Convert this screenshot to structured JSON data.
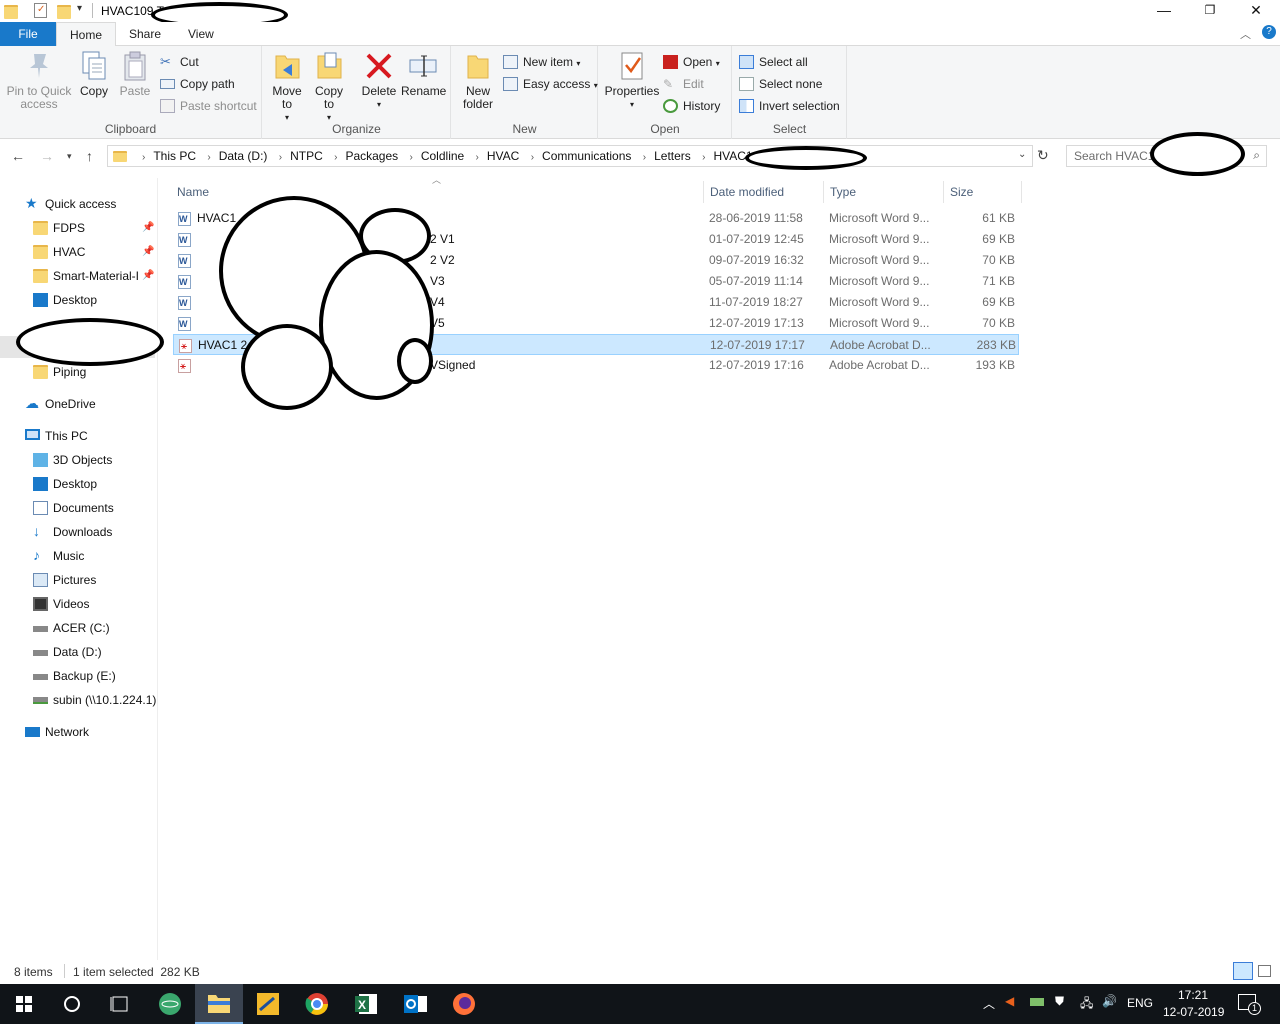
{
  "window": {
    "title": "HVAC109 T",
    "controls": [
      "minimize",
      "maximize",
      "close"
    ]
  },
  "tabs": [
    {
      "label": "File"
    },
    {
      "label": "Home"
    },
    {
      "label": "Share"
    },
    {
      "label": "View"
    }
  ],
  "ribbon": {
    "clipboard": {
      "label": "Clipboard",
      "pin": "Pin to Quick access",
      "copy": "Copy",
      "paste": "Paste",
      "cut": "Cut",
      "copy_path": "Copy path",
      "paste_shortcut": "Paste shortcut"
    },
    "organize": {
      "label": "Organize",
      "move_to": "Move to",
      "copy_to": "Copy to",
      "delete": "Delete",
      "rename": "Rename"
    },
    "new": {
      "label": "New",
      "new_folder": "New folder",
      "new_item": "New item",
      "easy_access": "Easy access"
    },
    "open": {
      "label": "Open",
      "properties": "Properties",
      "open": "Open",
      "edit": "Edit",
      "history": "History"
    },
    "select": {
      "label": "Select",
      "select_all": "Select all",
      "select_none": "Select none",
      "invert": "Invert selection"
    }
  },
  "address": {
    "crumbs": [
      "This PC",
      "Data (D:)",
      "NTPC",
      "Packages",
      "Coldline",
      "HVAC",
      "Communications",
      "Letters",
      "HVAC109"
    ],
    "search_placeholder": "Search HVAC1"
  },
  "sidebar": {
    "quick_access": "Quick access",
    "pinned": [
      {
        "label": "FDPS",
        "pinned": true
      },
      {
        "label": "HVAC",
        "pinned": true
      },
      {
        "label": "Smart-Material-I",
        "pinned": true
      },
      {
        "label": "Desktop",
        "pinned": false
      },
      {
        "label": "Piping",
        "pinned": false
      }
    ],
    "onedrive": "OneDrive",
    "this_pc": "This PC",
    "pc_items": [
      {
        "label": "3D Objects",
        "icon": "3d-objects-icon"
      },
      {
        "label": "Desktop",
        "icon": "desktop-icon"
      },
      {
        "label": "Documents",
        "icon": "documents-icon"
      },
      {
        "label": "Downloads",
        "icon": "downloads-icon"
      },
      {
        "label": "Music",
        "icon": "music-icon"
      },
      {
        "label": "Pictures",
        "icon": "pictures-icon"
      },
      {
        "label": "Videos",
        "icon": "videos-icon"
      },
      {
        "label": "ACER (C:)",
        "icon": "drive-icon"
      },
      {
        "label": "Data (D:)",
        "icon": "drive-icon"
      },
      {
        "label": "Backup (E:)",
        "icon": "drive-icon"
      },
      {
        "label": "subin (\\\\10.1.224.1)",
        "icon": "network-drive-icon"
      }
    ],
    "network": "Network"
  },
  "columns": {
    "name": "Name",
    "date": "Date modified",
    "type": "Type",
    "size": "Size"
  },
  "files": [
    {
      "name": "HVAC1",
      "date": "28-06-2019 11:58",
      "type": "Microsoft Word 9...",
      "size": "61 KB",
      "kind": "word",
      "selected": false
    },
    {
      "name": "2 V1",
      "date": "01-07-2019 12:45",
      "type": "Microsoft Word 9...",
      "size": "69 KB",
      "kind": "word",
      "selected": false
    },
    {
      "name": "2 V2",
      "date": "09-07-2019 16:32",
      "type": "Microsoft Word 9...",
      "size": "70 KB",
      "kind": "word",
      "selected": false
    },
    {
      "name": "V3",
      "date": "05-07-2019 11:14",
      "type": "Microsoft Word 9...",
      "size": "71 KB",
      "kind": "word",
      "selected": false
    },
    {
      "name": "V4",
      "date": "11-07-2019 18:27",
      "type": "Microsoft Word 9...",
      "size": "69 KB",
      "kind": "word",
      "selected": false
    },
    {
      "name": "V5",
      "date": "12-07-2019 17:13",
      "type": "Microsoft Word 9...",
      "size": "70 KB",
      "kind": "word",
      "selected": false
    },
    {
      "name": "HVAC1 2 Vetting",
      "date": "12-07-2019 17:17",
      "type": "Adobe Acrobat D...",
      "size": "283 KB",
      "kind": "pdf",
      "selected": true
    },
    {
      "name": "VSigned",
      "date": "12-07-2019 17:16",
      "type": "Adobe Acrobat D...",
      "size": "193 KB",
      "kind": "pdf",
      "selected": false
    }
  ],
  "status": {
    "items": "8 items",
    "selected": "1 item selected  282 KB"
  },
  "taskbar": {
    "time": "17:21",
    "date": "12-07-2019",
    "lang": "ENG",
    "notifications": "1"
  }
}
